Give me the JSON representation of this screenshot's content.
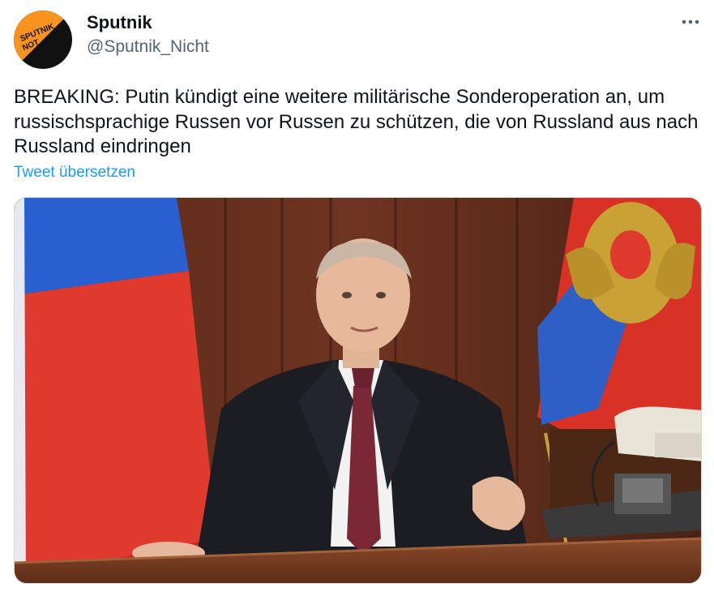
{
  "tweet": {
    "author_name": "Sputnik",
    "author_handle": "@Sputnik_Nicht",
    "avatar_text": "SPUTNIK NOT",
    "text": "BREAKING: Putin kündigt eine weitere militärische Sonderoperation an, um russischsprachige Russen vor Russen zu schützen, die von Russland aus nach Russland eindringen",
    "translate_label": "Tweet übersetzen",
    "more_icon": "more-horizontal-icon"
  },
  "colors": {
    "link": "#1d9bf0",
    "handle": "#536471",
    "text": "#0f1419",
    "avatar_orange": "#f7931e",
    "avatar_black": "#111111"
  }
}
